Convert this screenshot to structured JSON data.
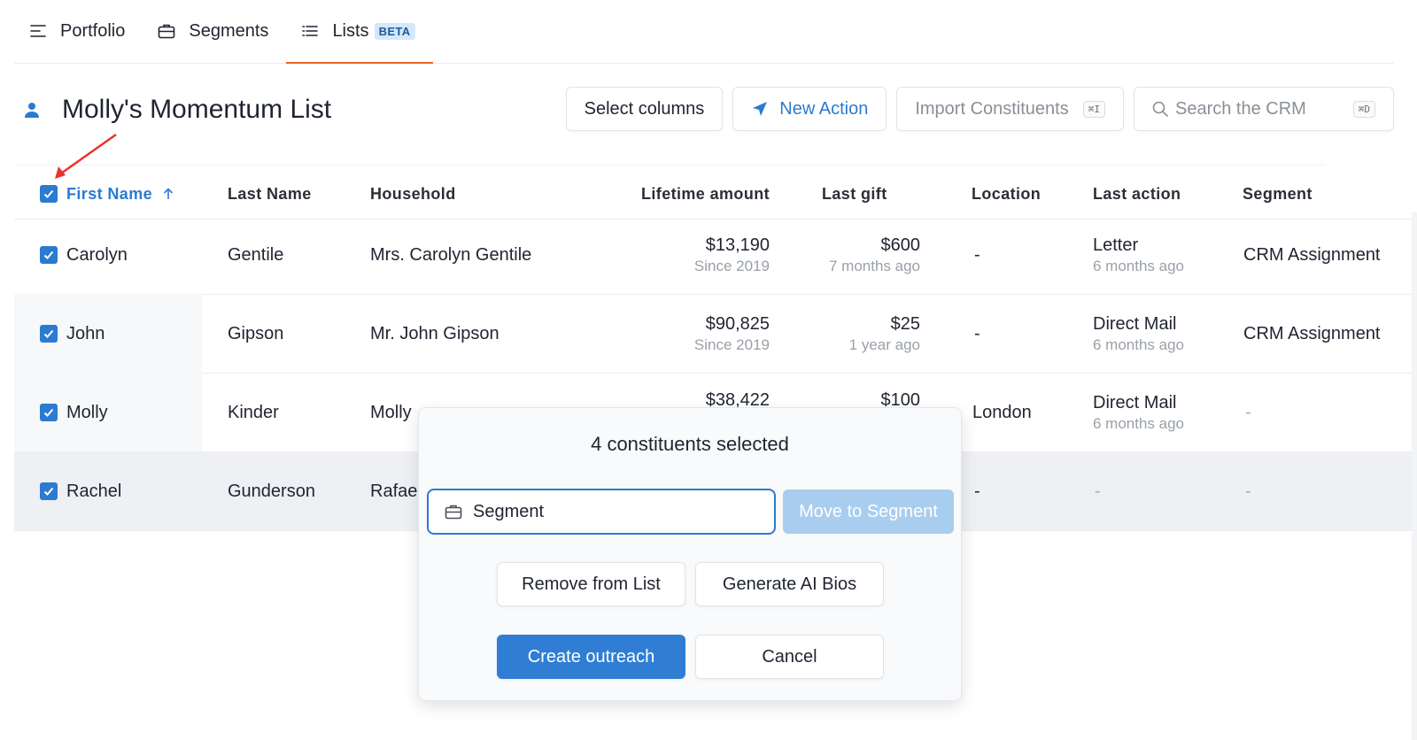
{
  "tabs": [
    {
      "label": "Portfolio",
      "icon": "align-left-icon"
    },
    {
      "label": "Segments",
      "icon": "briefcase-icon"
    },
    {
      "label": "Lists",
      "icon": "list-icon",
      "badge": "BETA",
      "active": true
    }
  ],
  "header": {
    "title": "Molly's Momentum List",
    "select_columns": "Select columns",
    "new_action": "New Action",
    "import": "Import Constituents",
    "import_shortcut": "⌘I",
    "search_placeholder": "Search the CRM",
    "search_shortcut": "⌘D"
  },
  "table": {
    "columns": [
      "First Name",
      "Last Name",
      "Household",
      "Lifetime amount",
      "Last gift",
      "Location",
      "Last action",
      "Segment"
    ],
    "rows": [
      {
        "first": "Carolyn",
        "last": "Gentile",
        "household": "Mrs. Carolyn Gentile",
        "lifetime": "$13,190",
        "lifetime_sub": "Since 2019",
        "gift": "$600",
        "gift_sub": "7 months ago",
        "location": "-",
        "action": "Letter",
        "action_sub": "6 months ago",
        "segment": "CRM Assignment"
      },
      {
        "first": "John",
        "last": "Gipson",
        "household": "Mr. John Gipson",
        "lifetime": "$90,825",
        "lifetime_sub": "Since 2019",
        "gift": "$25",
        "gift_sub": "1 year ago",
        "location": "-",
        "action": "Direct Mail",
        "action_sub": "6 months ago",
        "segment": "CRM Assignment"
      },
      {
        "first": "Molly",
        "last": "Kinder",
        "household": "Molly",
        "lifetime": "$38,422",
        "lifetime_sub": "",
        "gift": "$100",
        "gift_sub": "",
        "location": "London",
        "action": "Direct Mail",
        "action_sub": "6 months ago",
        "segment": "-"
      },
      {
        "first": "Rachel",
        "last": "Gunderson",
        "household": "Rafae",
        "lifetime": "",
        "lifetime_sub": "",
        "gift": "",
        "gift_sub": "",
        "location": "-",
        "action": "-",
        "action_sub": "",
        "segment": "-"
      }
    ]
  },
  "modal": {
    "title": "4 constituents selected",
    "segment_value": "Segment",
    "move": "Move to Segment",
    "remove": "Remove from List",
    "generate": "Generate AI Bios",
    "create": "Create outreach",
    "cancel": "Cancel"
  },
  "colors": {
    "accent": "#2b7bd0",
    "tab_underline": "#e8642c",
    "annotation_arrow": "#e8322a"
  }
}
